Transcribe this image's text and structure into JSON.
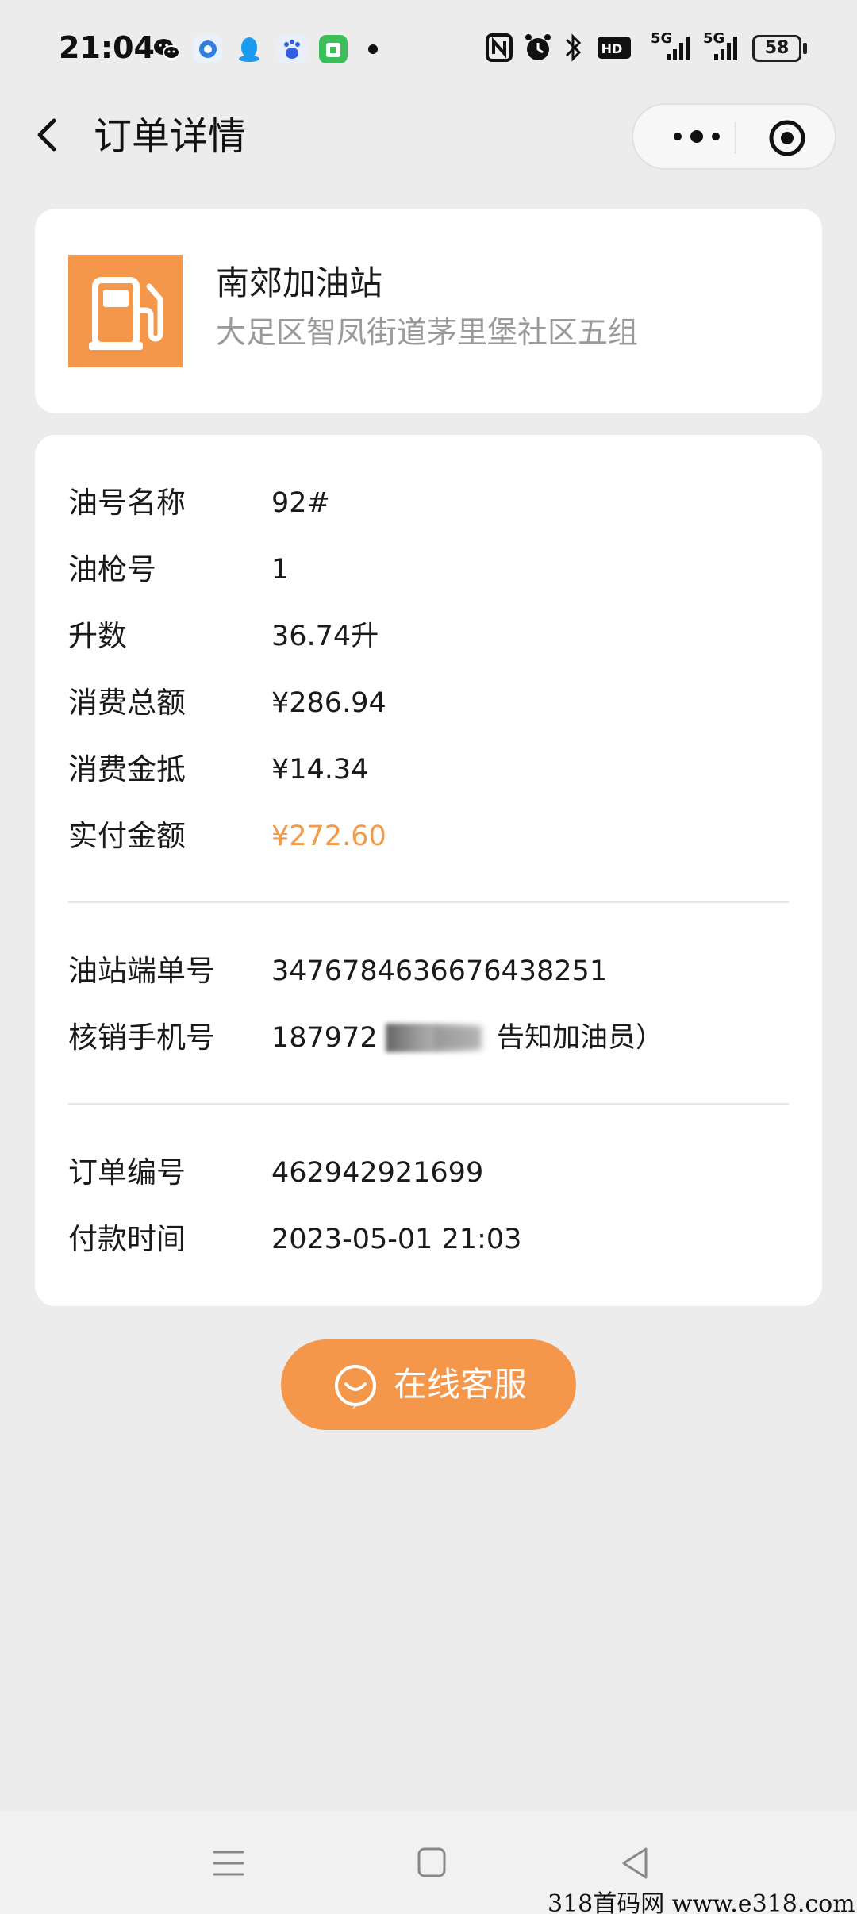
{
  "status_bar": {
    "time": "21:04",
    "battery": "58",
    "network_label_1": "5G",
    "network_label_2": "5G",
    "hd_label": "HD"
  },
  "header": {
    "title": "订单详情",
    "back_icon": "chevron-left-icon",
    "more_icon": "more-dots-icon",
    "close_icon": "target-close-icon"
  },
  "station": {
    "name": "南郊加油站",
    "address": "大足区智凤街道茅里堡社区五组",
    "logo_icon": "fuel-pump-icon",
    "logo_color": "#f5974a"
  },
  "details": {
    "fuel_grade": {
      "label": "油号名称",
      "value": "92#"
    },
    "nozzle": {
      "label": "油枪号",
      "value": "1"
    },
    "liters": {
      "label": "升数",
      "value": "36.74升"
    },
    "total": {
      "label": "消费总额",
      "value": "¥286.94"
    },
    "discount": {
      "label": "消费金抵",
      "value": "¥14.34"
    },
    "paid": {
      "label": "实付金额",
      "value": "¥272.60"
    },
    "station_order": {
      "label": "油站端单号",
      "value": "3476784636676438251"
    },
    "phone": {
      "label": "核销手机号",
      "value_prefix": "187972",
      "value_suffix": "告知加油员）"
    },
    "order_no": {
      "label": "订单编号",
      "value": "462942921699"
    },
    "pay_time": {
      "label": "付款时间",
      "value": "2023-05-01 21:03"
    }
  },
  "service": {
    "label": "在线客服",
    "icon": "chat-smile-icon"
  },
  "nav_bar": {
    "menu_icon": "menu-icon",
    "home_icon": "square-home-icon",
    "back_icon": "triangle-back-icon"
  },
  "watermark": "318首码网  www.e318.com",
  "colors": {
    "accent": "#f29a48",
    "background": "#ececec",
    "card": "#ffffff",
    "secondary_text": "#9a9a9a"
  }
}
